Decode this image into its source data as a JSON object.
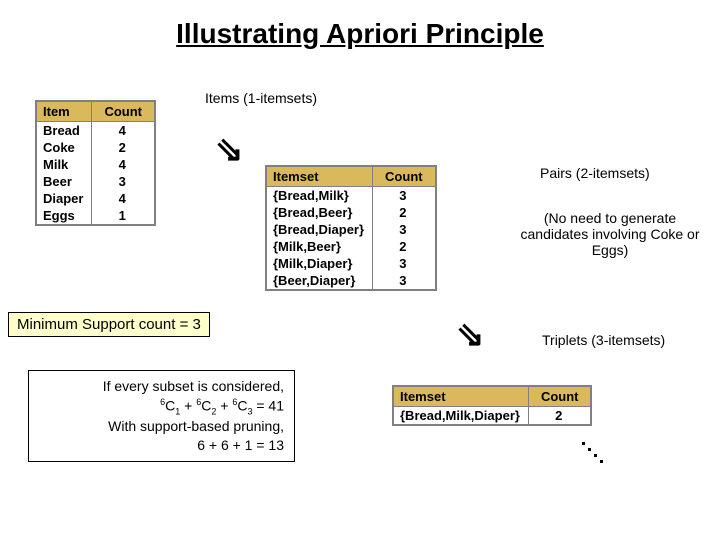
{
  "title": "Illustrating Apriori Principle",
  "labels": {
    "items1": "Items (1-itemsets)",
    "pairs": "Pairs (2-itemsets)",
    "note_pairs": "(No need to generate candidates involving Coke or Eggs)",
    "triplets": "Triplets (3-itemsets)"
  },
  "support_box": "Minimum Support count = 3",
  "calc": {
    "line1": "If every subset is considered,",
    "combo_eq": " = 41",
    "line3": "With support-based pruning,",
    "line4": "6 + 6 + 1 = 13"
  },
  "table1": {
    "headers": [
      "Item",
      "Count"
    ],
    "rows": [
      [
        "Bread",
        "4"
      ],
      [
        "Coke",
        "2"
      ],
      [
        "Milk",
        "4"
      ],
      [
        "Beer",
        "3"
      ],
      [
        "Diaper",
        "4"
      ],
      [
        "Eggs",
        "1"
      ]
    ]
  },
  "table2": {
    "headers": [
      "Itemset",
      "Count"
    ],
    "rows": [
      [
        "{Bread,Milk}",
        "3"
      ],
      [
        "{Bread,Beer}",
        "2"
      ],
      [
        "{Bread,Diaper}",
        "3"
      ],
      [
        "{Milk,Beer}",
        "2"
      ],
      [
        "{Milk,Diaper}",
        "3"
      ],
      [
        "{Beer,Diaper}",
        "3"
      ]
    ]
  },
  "table3": {
    "headers": [
      "Itemset",
      "Count"
    ],
    "rows": [
      [
        "{Bread,Milk,Diaper}",
        "2"
      ]
    ]
  }
}
